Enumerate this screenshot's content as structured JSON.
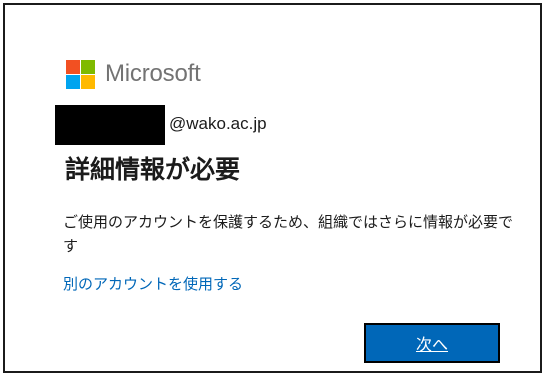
{
  "brand": {
    "name": "Microsoft",
    "logo_colors": [
      "#f25022",
      "#7fba00",
      "#00a4ef",
      "#ffb900"
    ]
  },
  "identity": {
    "email_domain": "@wako.ac.jp"
  },
  "content": {
    "title": "詳細情報が必要",
    "description": "ご使用のアカウントを保護するため、組織ではさらに情報が必要です",
    "other_account_link": "別のアカウントを使用する"
  },
  "actions": {
    "next_label": "次へ"
  },
  "colors": {
    "accent": "#0067b8",
    "text": "#1b1b1b",
    "logo_text": "#737373"
  }
}
